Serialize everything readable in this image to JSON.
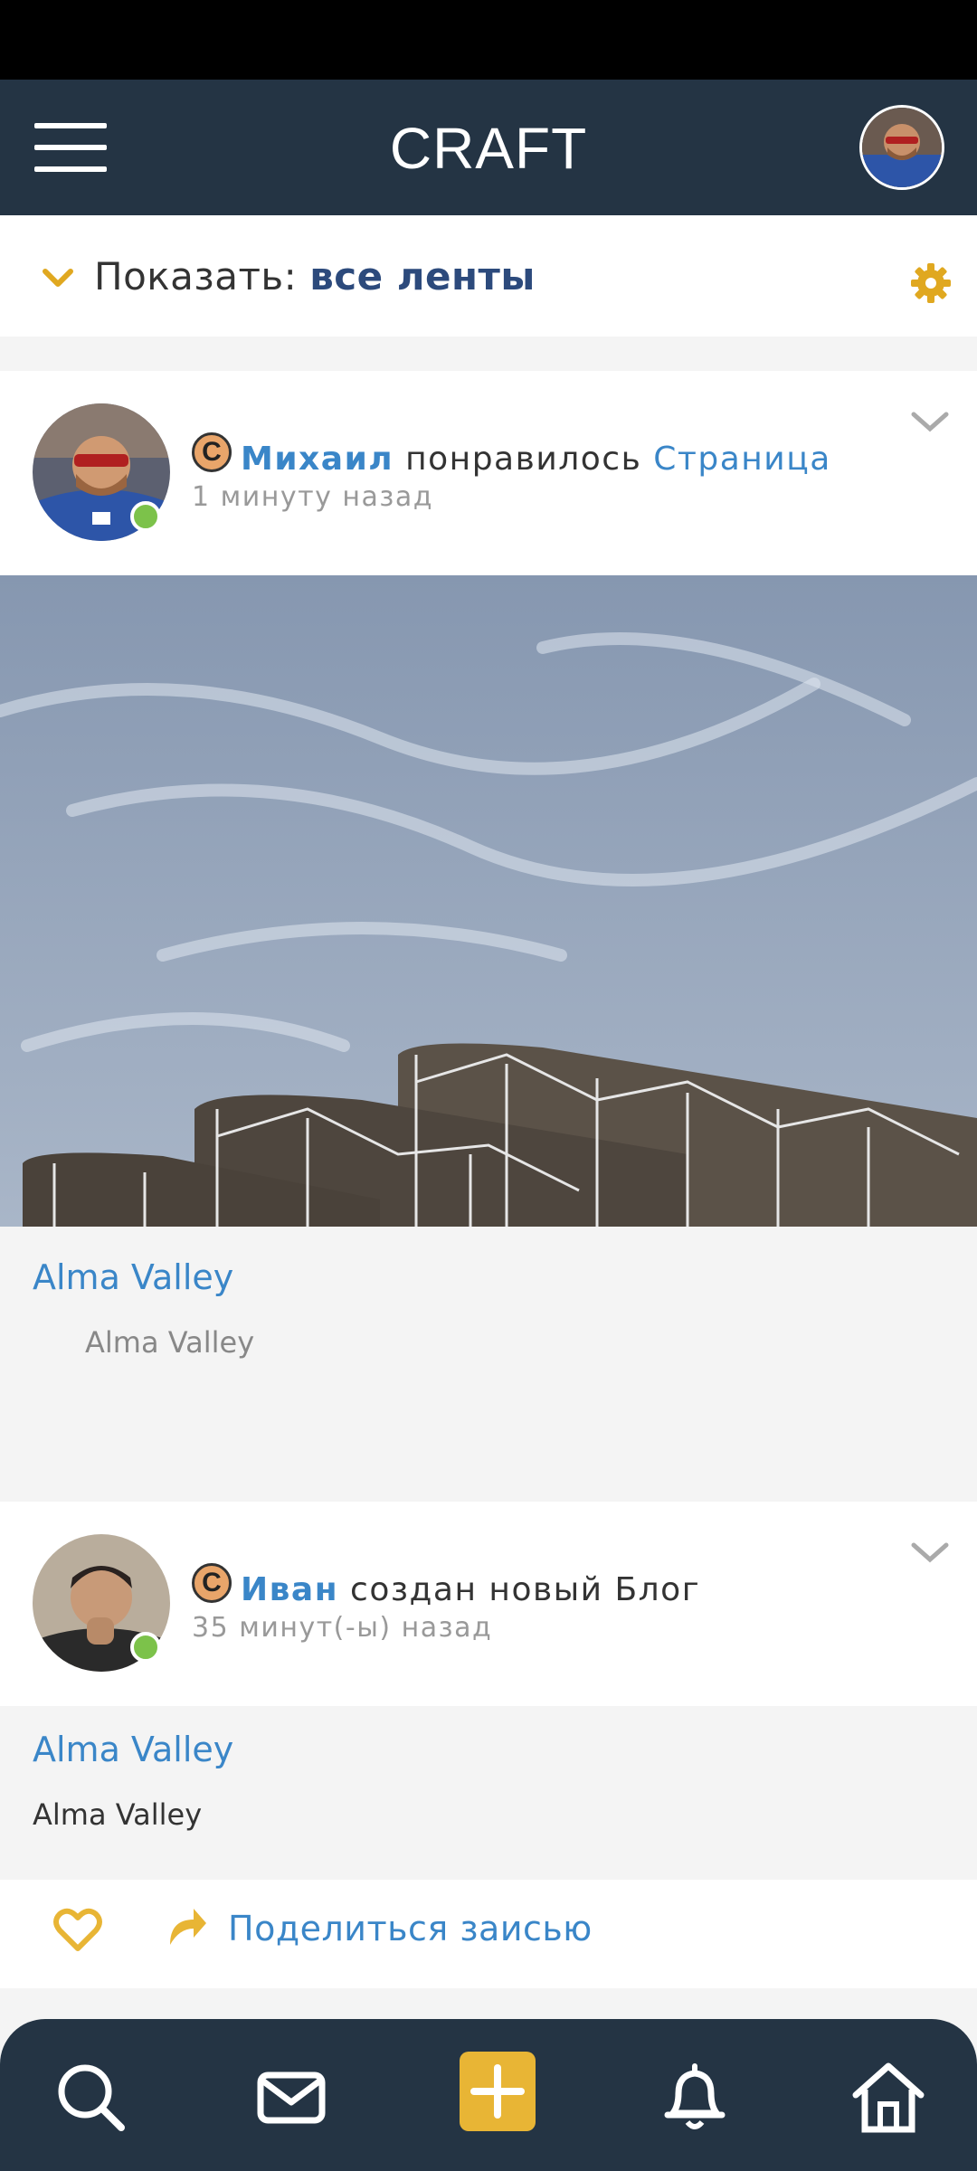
{
  "header": {
    "title": "CRAFT",
    "accent_color": "#243444"
  },
  "filter": {
    "label": "Показать:",
    "value": "все ленты"
  },
  "feed": [
    {
      "badge": "C",
      "user": "Михаил",
      "action": "понравилось",
      "object": "Страница",
      "time": "1 минуту назад",
      "place_title": "Alma Valley",
      "place_subtitle": "Alma Valley"
    },
    {
      "badge": "C",
      "user": "Иван",
      "action": "создан новый Блог",
      "time": "35 минут(-ы) назад",
      "place_title": "Alma Valley",
      "place_subtitle": "Alma Valley",
      "share_label": "Поделиться заисью"
    }
  ],
  "colors": {
    "link": "#3a86c8",
    "accent_gold": "#e8b535",
    "online": "#7cc24a"
  },
  "icons": [
    "menu-icon",
    "settings-gear-icon",
    "chevron-down-icon",
    "heart-icon",
    "share-arrow-icon",
    "search-icon",
    "mail-icon",
    "plus-icon",
    "bell-icon",
    "home-icon"
  ]
}
